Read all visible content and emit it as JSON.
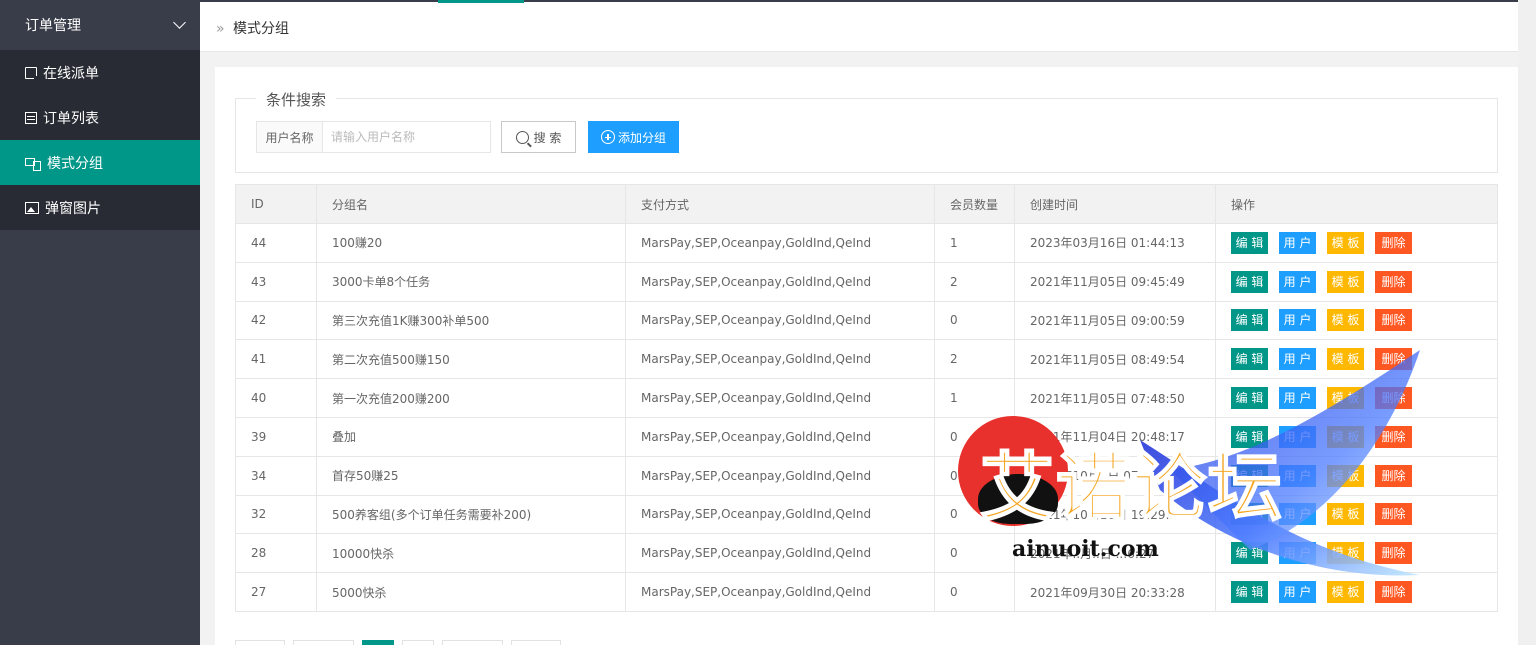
{
  "sidebar": {
    "header": "订单管理",
    "items": [
      {
        "label": "在线派单",
        "icon": "document-icon",
        "active": false
      },
      {
        "label": "订单列表",
        "icon": "list-icon",
        "active": false
      },
      {
        "label": "模式分组",
        "icon": "group-icon",
        "active": true
      },
      {
        "label": "弹窗图片",
        "icon": "image-icon",
        "active": false
      }
    ]
  },
  "breadcrumb": {
    "separator": "»",
    "current": "模式分组"
  },
  "search": {
    "legend": "条件搜索",
    "field_label": "用户名称",
    "placeholder": "请输入用户名称",
    "value": "",
    "search_button": "搜 索",
    "add_button": "添加分组"
  },
  "table": {
    "headers": [
      "ID",
      "分组名",
      "支付方式",
      "会员数量",
      "创建时间",
      "操作"
    ],
    "actions": {
      "edit": "编 辑",
      "user": "用 户",
      "template": "模 板",
      "delete": "删除"
    },
    "rows": [
      {
        "id": "44",
        "name": "100赚20",
        "pay": "MarsPay,SEP,Oceanpay,GoldInd,QeInd",
        "count": "1",
        "time": "2023年03月16日 01:44:13"
      },
      {
        "id": "43",
        "name": "3000卡单8个任务",
        "pay": "MarsPay,SEP,Oceanpay,GoldInd,QeInd",
        "count": "2",
        "time": "2021年11月05日 09:45:49"
      },
      {
        "id": "42",
        "name": "第三次充值1K赚300补单500",
        "pay": "MarsPay,SEP,Oceanpay,GoldInd,QeInd",
        "count": "0",
        "time": "2021年11月05日 09:00:59"
      },
      {
        "id": "41",
        "name": "第二次充值500赚150",
        "pay": "MarsPay,SEP,Oceanpay,GoldInd,QeInd",
        "count": "2",
        "time": "2021年11月05日 08:49:54"
      },
      {
        "id": "40",
        "name": "第一次充值200赚200",
        "pay": "MarsPay,SEP,Oceanpay,GoldInd,QeInd",
        "count": "1",
        "time": "2021年11月05日 07:48:50"
      },
      {
        "id": "39",
        "name": "叠加",
        "pay": "MarsPay,SEP,Oceanpay,GoldInd,QeInd",
        "count": "0",
        "time": "2021年11月04日 20:48:17"
      },
      {
        "id": "34",
        "name": "首存50赚25",
        "pay": "MarsPay,SEP,Oceanpay,GoldInd,QeInd",
        "count": "0",
        "time": "2021年10月..日 07:..:.."
      },
      {
        "id": "32",
        "name": "500养客组(多个订单任务需要补200)",
        "pay": "MarsPay,SEP,Oceanpay,GoldInd,QeInd",
        "count": "0",
        "time": "2021年10月10日 19:29:50"
      },
      {
        "id": "28",
        "name": "10000快杀",
        "pay": "MarsPay,SEP,Oceanpay,GoldInd,QeInd",
        "count": "0",
        "time": "2021年..月..日 ..:6:27"
      },
      {
        "id": "27",
        "name": "5000快杀",
        "pay": "MarsPay,SEP,Oceanpay,GoldInd,QeInd",
        "count": "0",
        "time": "2021年09月30日 20:33:28"
      }
    ]
  },
  "watermark": {
    "text": "艾诺论坛",
    "url": "ainuoit.com"
  },
  "colors": {
    "sidebar_bg": "#393d49",
    "accent": "#009688",
    "blue": "#1e9fff",
    "yellow": "#ffb800",
    "red": "#ff5722"
  }
}
